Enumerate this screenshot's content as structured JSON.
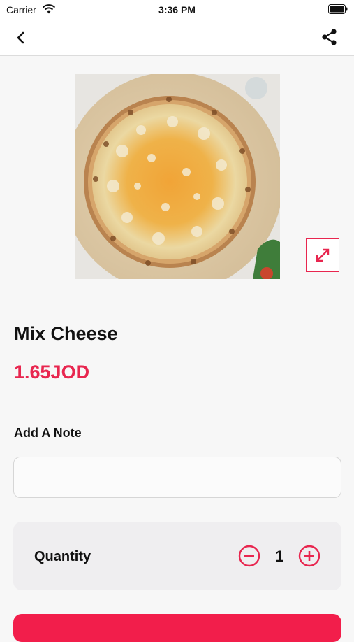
{
  "status_bar": {
    "carrier": "Carrier",
    "time": "3:36 PM",
    "icons": [
      "wifi-icon",
      "battery-icon"
    ]
  },
  "nav": {
    "back_icon": "chevron-left-icon",
    "share_icon": "share-icon"
  },
  "product": {
    "name": "Mix Cheese",
    "price": "1.65JOD",
    "image_icon": "expand-icon"
  },
  "note": {
    "label": "Add A Note",
    "value": "",
    "placeholder": ""
  },
  "quantity": {
    "label": "Quantity",
    "value": "1",
    "decrement_icon": "minus-circle-icon",
    "increment_icon": "plus-circle-icon"
  },
  "colors": {
    "accent": "#e8264f",
    "button": "#f21e4b",
    "background": "#f7f7f7"
  }
}
